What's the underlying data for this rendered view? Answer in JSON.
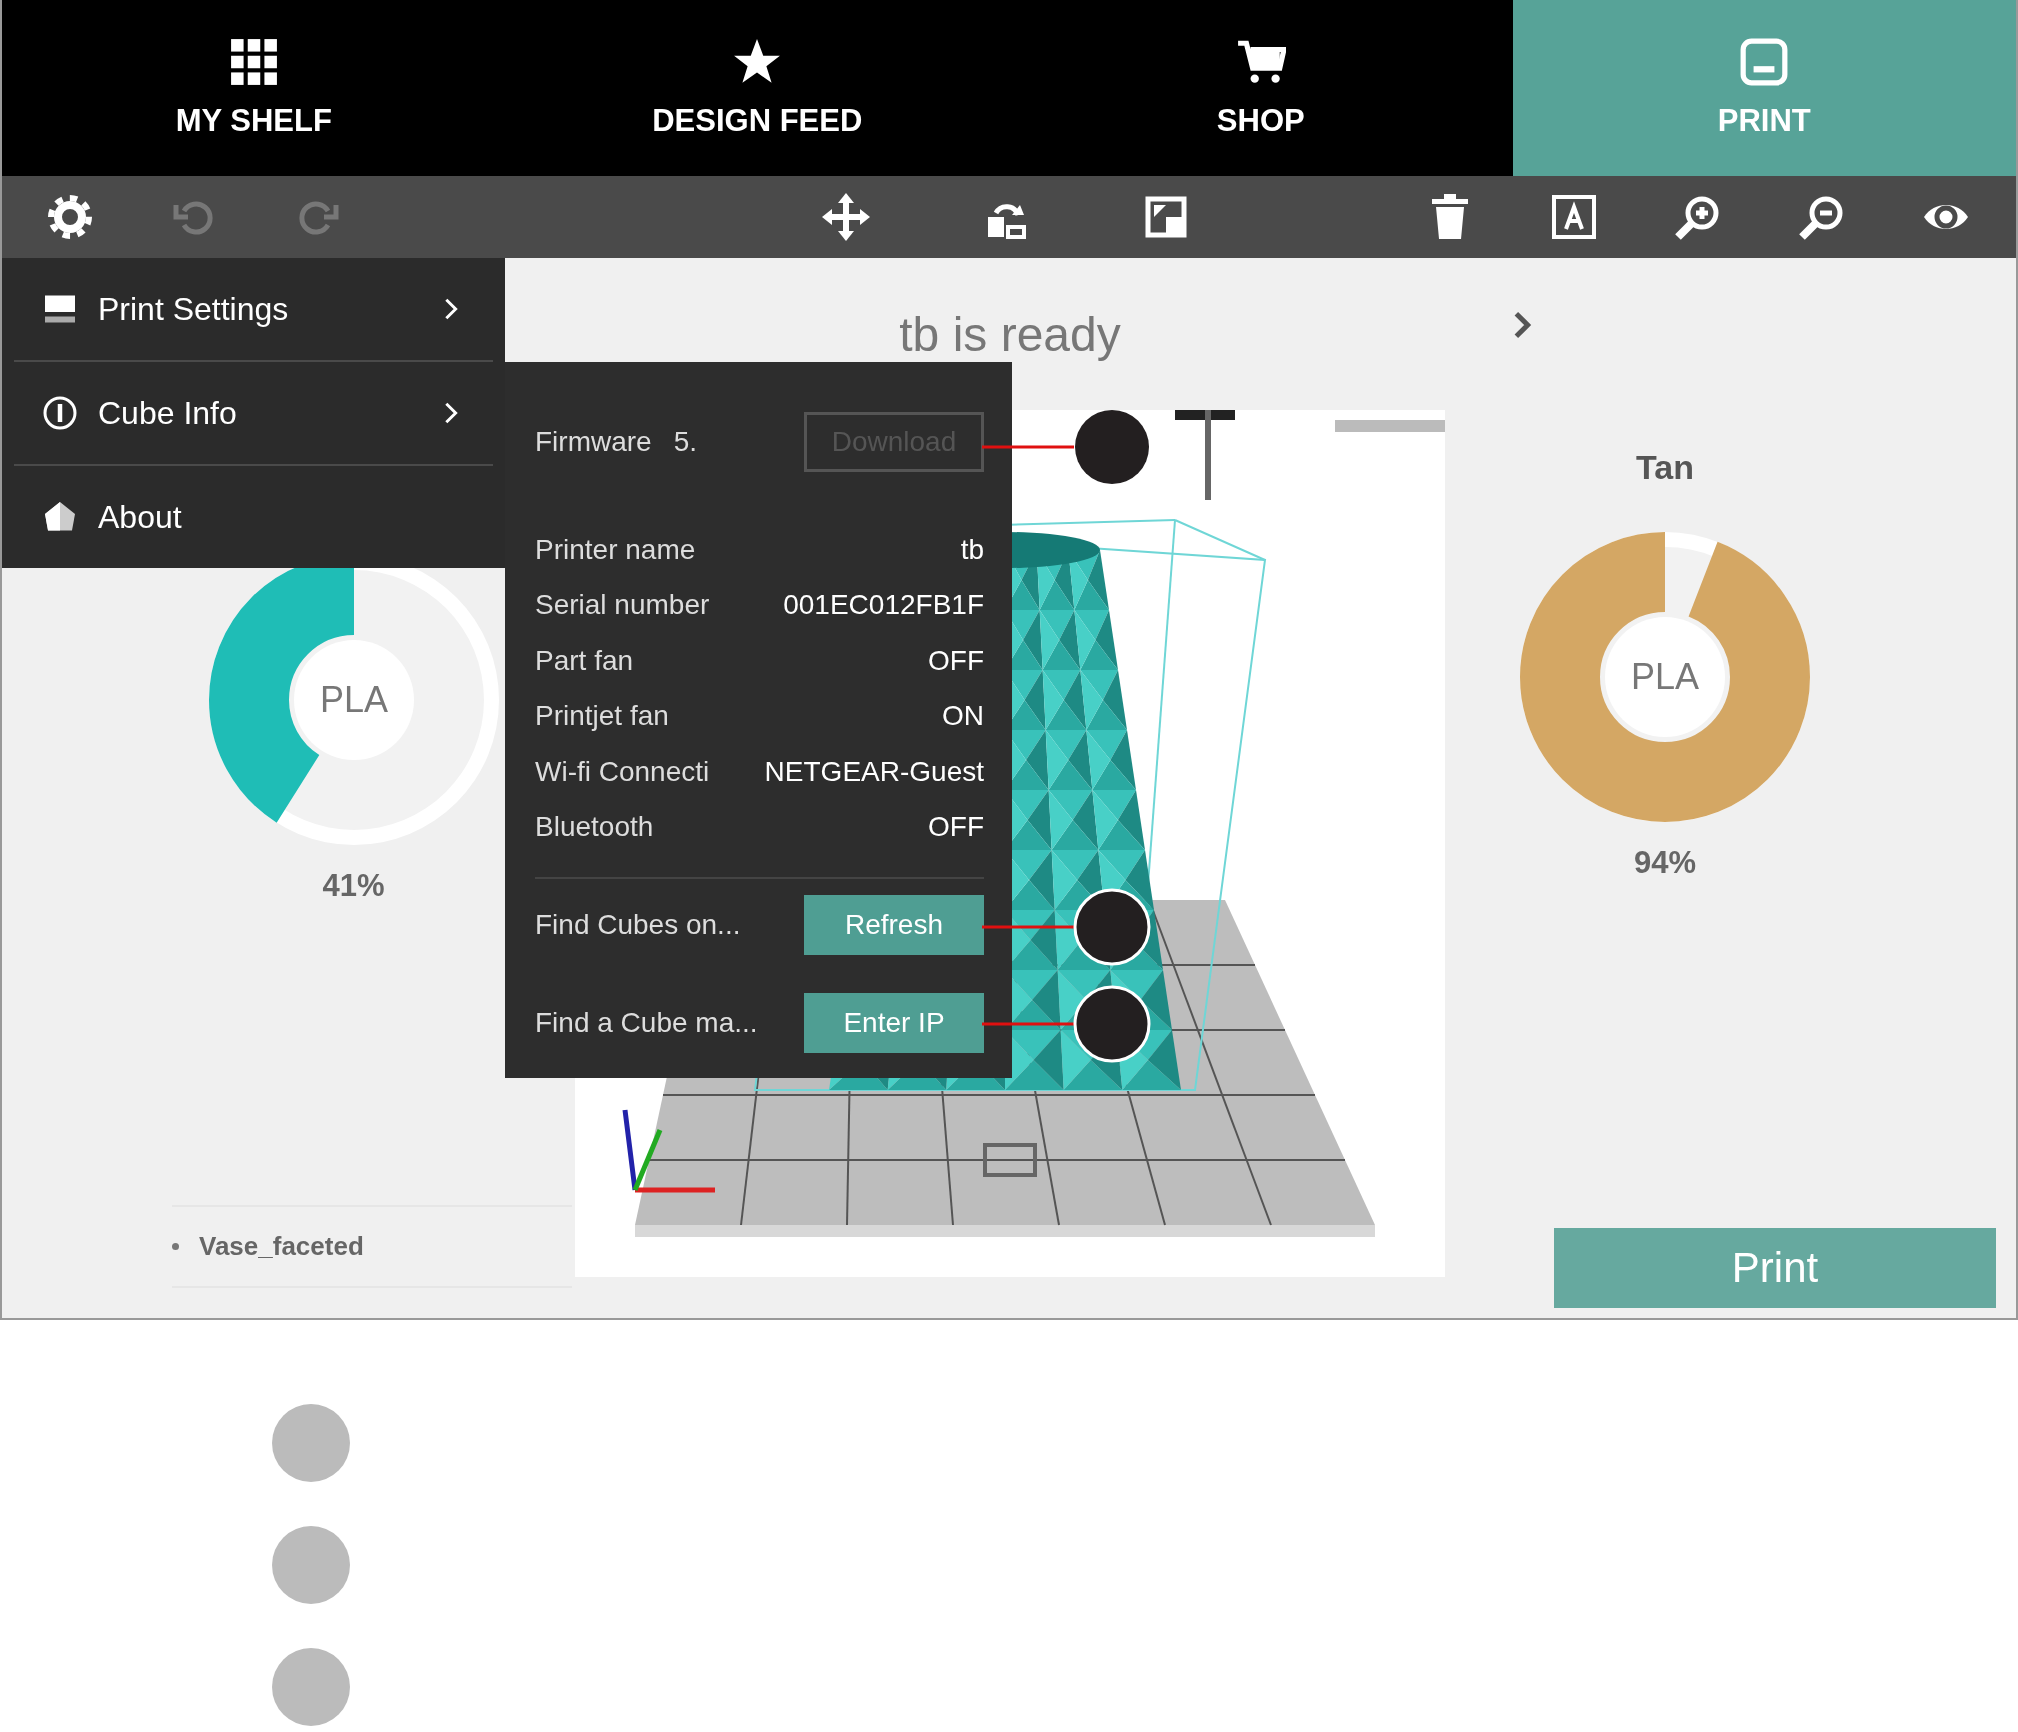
{
  "nav_tabs": [
    {
      "label": "MY SHELF",
      "kind": "grid",
      "selected": false
    },
    {
      "label": "DESIGN FEED",
      "kind": "star",
      "selected": false
    },
    {
      "label": "SHOP",
      "kind": "cart",
      "selected": false
    },
    {
      "label": "PRINT",
      "kind": "printer",
      "selected": true
    }
  ],
  "toolbar": [
    {
      "kind": "settings",
      "disabled": false
    },
    {
      "kind": "undo",
      "disabled": true
    },
    {
      "kind": "redo",
      "disabled": true
    },
    {
      "kind": "move",
      "disabled": false
    },
    {
      "kind": "rotate",
      "disabled": false
    },
    {
      "kind": "scale",
      "disabled": false
    },
    {
      "kind": "delete",
      "disabled": false
    },
    {
      "kind": "frame",
      "disabled": false
    },
    {
      "kind": "zoom_in",
      "disabled": false
    },
    {
      "kind": "zoom_out",
      "disabled": false
    },
    {
      "kind": "view",
      "disabled": false
    }
  ],
  "menu": [
    {
      "label": "Print Settings",
      "kind": "settings",
      "submenu": true
    },
    {
      "label": "Cube Info",
      "kind": "info",
      "submenu": true
    },
    {
      "label": "About",
      "kind": "about",
      "submenu": false
    }
  ],
  "status_title": "tb is ready",
  "cube_info": {
    "firmware": {
      "label": "Firmware",
      "value": "5.",
      "button": {
        "label": "Download",
        "disabled": true
      }
    },
    "rows": [
      {
        "label": "Printer name",
        "value": "tb"
      },
      {
        "label": "Serial number",
        "value": "001EC012FB1F"
      },
      {
        "label": "Part fan",
        "value": "OFF"
      },
      {
        "label": "Printjet fan",
        "value": "ON"
      },
      {
        "label": "Wi-fi Connecti",
        "value": "NETGEAR-Guest"
      },
      {
        "label": "Bluetooth",
        "value": "OFF"
      }
    ],
    "actions": [
      {
        "label": "Find Cubes on...",
        "button": "Refresh"
      },
      {
        "label": "Find a Cube ma...",
        "button": "Enter IP"
      }
    ]
  },
  "filaments": [
    {
      "material": "PLA",
      "percent": "41%",
      "level": 0.41,
      "color": "#1fbdb6"
    },
    {
      "name": "Tan",
      "material": "PLA",
      "percent": "94%",
      "level": 0.94,
      "color": "#d4a764"
    }
  ],
  "models": [
    {
      "name": "Vase_faceted"
    }
  ],
  "print_button": "Print"
}
